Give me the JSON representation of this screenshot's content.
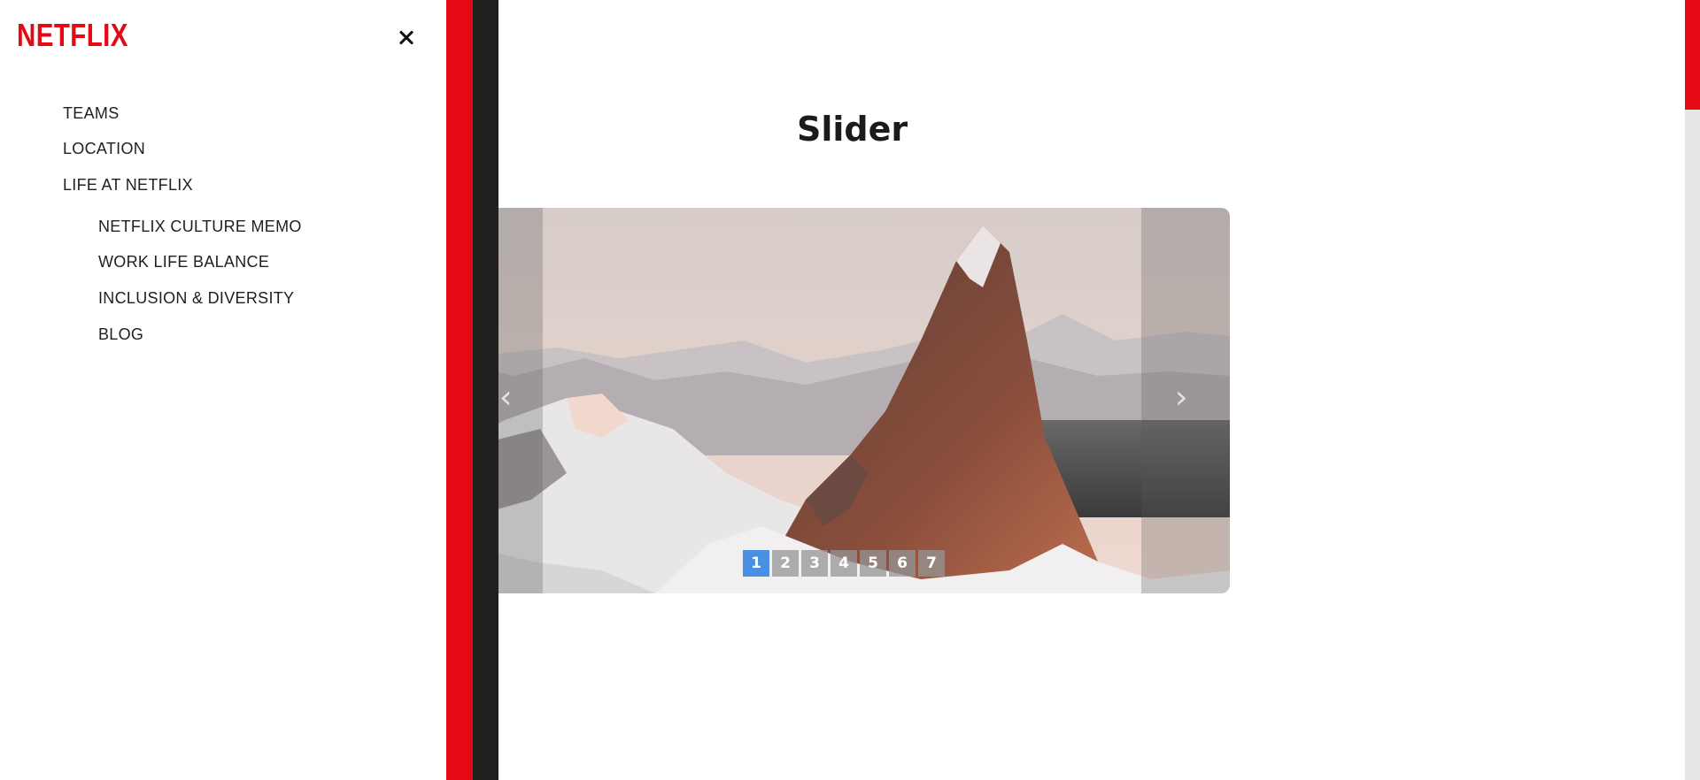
{
  "brand": {
    "logo_text": "NETFLIX",
    "color": "#e50914"
  },
  "drawer": {
    "close_icon": "close-icon",
    "nav": [
      {
        "label": "TEAMS",
        "level": 1
      },
      {
        "label": "LOCATION",
        "level": 1
      },
      {
        "label": "LIFE AT NETFLIX",
        "level": 1
      },
      {
        "label": "NETFLIX CULTURE MEMO",
        "level": 2
      },
      {
        "label": "WORK LIFE BALANCE",
        "level": 2
      },
      {
        "label": "INCLUSION & DIVERSITY",
        "level": 2
      },
      {
        "label": "BLOG",
        "level": 2
      }
    ]
  },
  "main": {
    "title": "Slider",
    "slider": {
      "image_subject": "snowy mountain peak above a fjord",
      "next_icon": "chevron-right-icon",
      "prev_icon": "chevron-left-icon",
      "pages": [
        "1",
        "2",
        "3",
        "4",
        "5",
        "6",
        "7"
      ],
      "active_page": "1"
    }
  },
  "colors": {
    "accent": "#e50914",
    "dark": "#221f1f",
    "active_page": "#4a90e2"
  }
}
